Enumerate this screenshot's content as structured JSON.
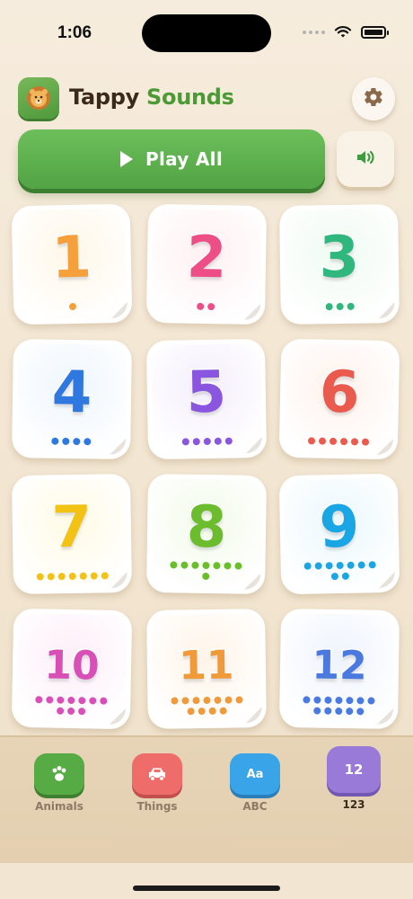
{
  "status": {
    "time": "1:06"
  },
  "header": {
    "title_part1": "Tappy ",
    "title_part2": "Sounds",
    "logo_icon": "lion-icon",
    "settings_icon": "gear-icon"
  },
  "controls": {
    "play_all_label": "Play All",
    "sound_icon": "speaker-icon"
  },
  "tiles": [
    {
      "label": "1",
      "color": "#f5a03a",
      "bg": "#fff7e8",
      "dots": 1
    },
    {
      "label": "2",
      "color": "#ee4e86",
      "bg": "#fff0f3",
      "dots": 2
    },
    {
      "label": "3",
      "color": "#2fb77d",
      "bg": "#effaf2",
      "dots": 3
    },
    {
      "label": "4",
      "color": "#2f78e0",
      "bg": "#eef6fd",
      "dots": 4
    },
    {
      "label": "5",
      "color": "#8a56e0",
      "bg": "#f4eefc",
      "dots": 5
    },
    {
      "label": "6",
      "color": "#ea5a4d",
      "bg": "#fff2ec",
      "dots": 6
    },
    {
      "label": "7",
      "color": "#f2c315",
      "bg": "#fffbe6",
      "dots": 7
    },
    {
      "label": "8",
      "color": "#6cbd2e",
      "bg": "#f2fbea",
      "dots": 8
    },
    {
      "label": "9",
      "color": "#1aa6e4",
      "bg": "#ebf8fd",
      "dots": 9
    },
    {
      "label": "10",
      "color": "#d94fb8",
      "bg": "#fdeef8",
      "dots": 10
    },
    {
      "label": "11",
      "color": "#f09a3a",
      "bg": "#fff4e8",
      "dots": 11
    },
    {
      "label": "12",
      "color": "#4a7ae0",
      "bg": "#eef4fd",
      "dots": 12
    }
  ],
  "tabs": [
    {
      "label": "Animals",
      "icon": "paw-icon",
      "color": "#56ab45",
      "shadow": "#3e8030",
      "active": false
    },
    {
      "label": "Things",
      "icon": "car-icon",
      "color": "#ee6d6a",
      "shadow": "#c24f4c",
      "active": false
    },
    {
      "label": "ABC",
      "icon": "letters-icon",
      "glyph": "Aa",
      "color": "#3aa4e8",
      "shadow": "#2a7fb8",
      "active": false
    },
    {
      "label": "123",
      "icon": "numbers-icon",
      "glyph": "12",
      "color": "#9a7ad9",
      "shadow": "#7258b3",
      "active": true
    }
  ]
}
